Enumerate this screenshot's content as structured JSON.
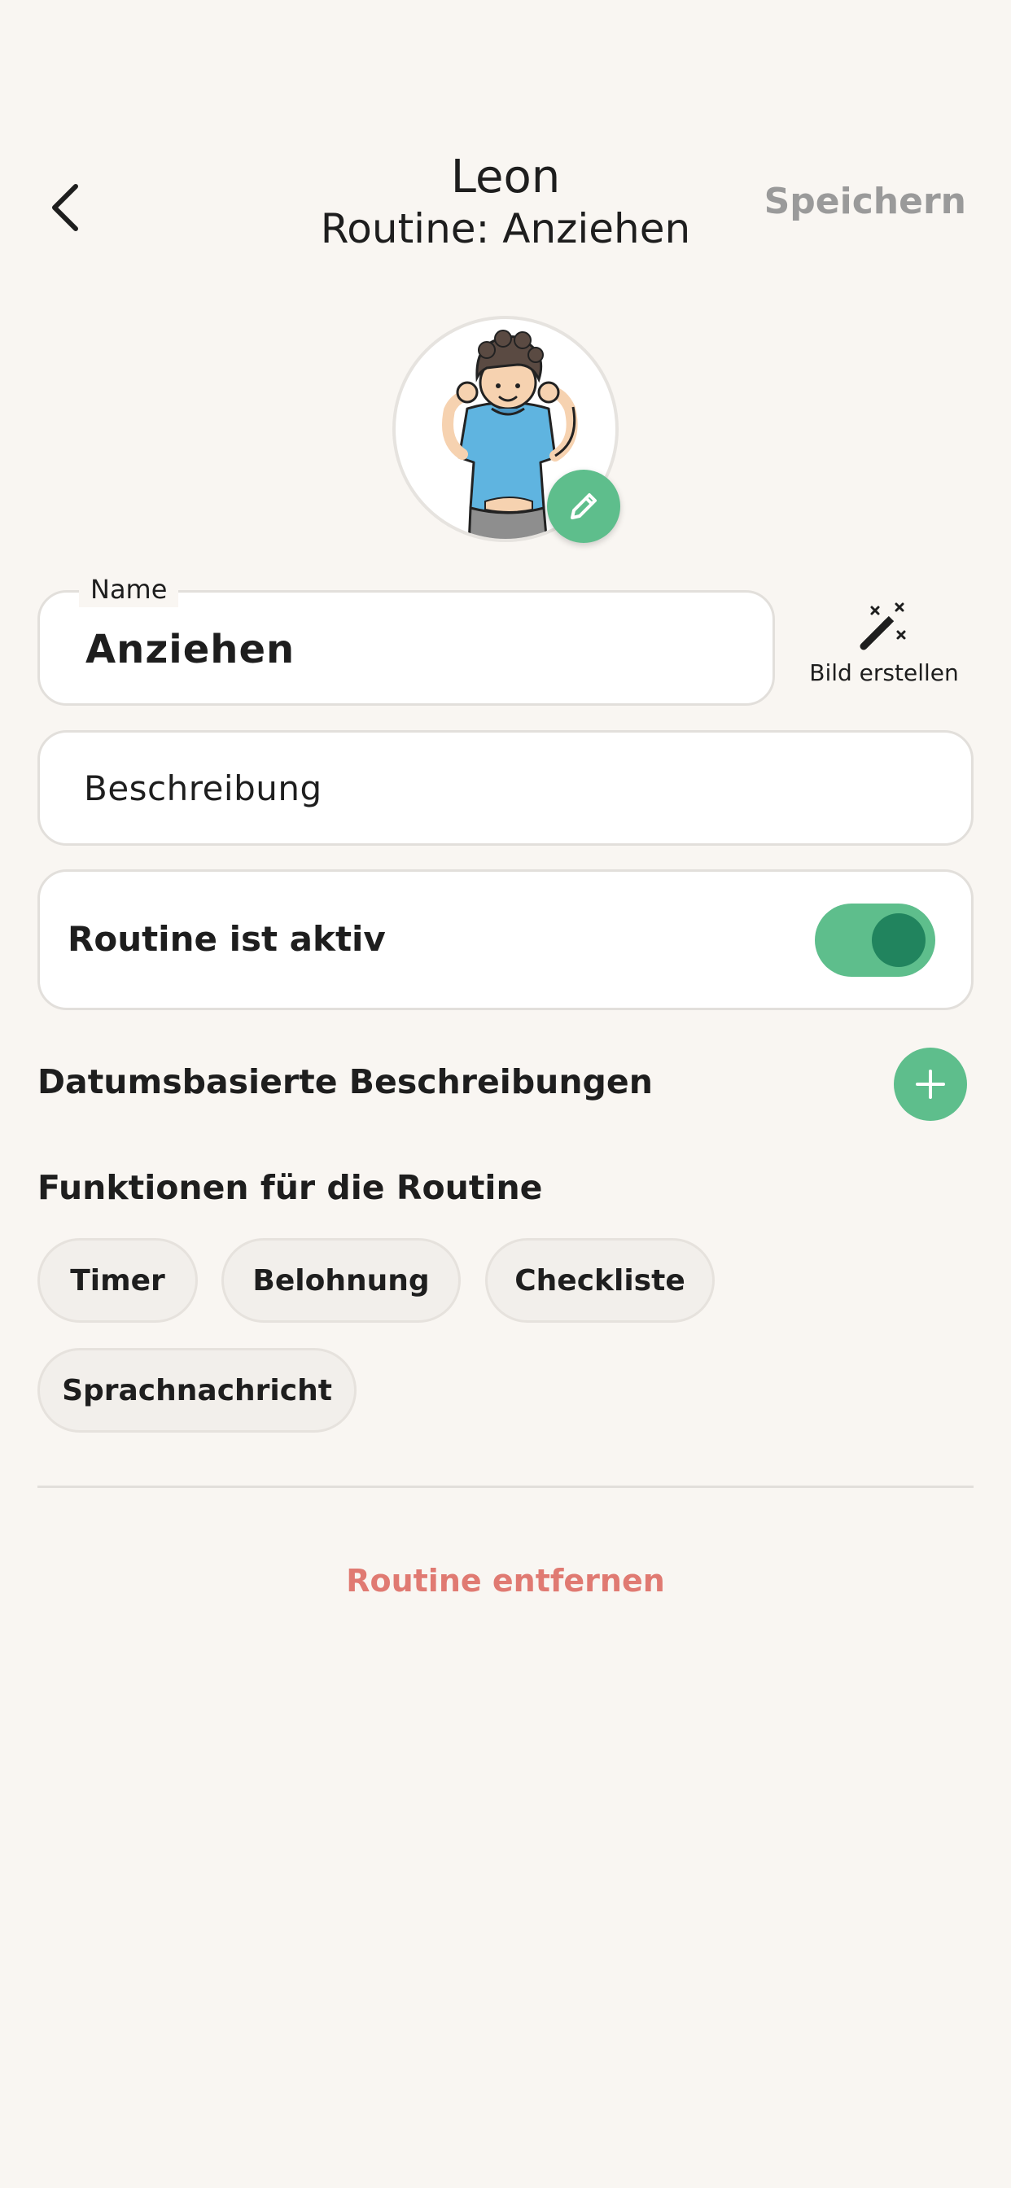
{
  "header": {
    "child_name": "Leon",
    "routine_title": "Routine: Anziehen",
    "save_label": "Speichern"
  },
  "avatar": {
    "icon": "child-putting-on-shirt-illustration",
    "edit_icon": "pencil-icon"
  },
  "form": {
    "name_label": "Name",
    "name_value": "Anziehen",
    "create_image_label": "Bild erstellen",
    "description_placeholder": "Beschreibung",
    "active_label": "Routine ist aktiv",
    "active": true
  },
  "date_descriptions": {
    "title": "Datumsbasierte Beschreibungen"
  },
  "functions": {
    "title": "Funktionen für die Routine",
    "chips": [
      "Timer",
      "Belohnung",
      "Checkliste",
      "Sprachnachricht"
    ]
  },
  "remove_label": "Routine entfernen",
  "colors": {
    "background": "#f9f6f2",
    "accent": "#5ebe8c",
    "accent_dark": "#21845e",
    "save_disabled": "#9a9a9a",
    "danger": "#e07a72"
  }
}
